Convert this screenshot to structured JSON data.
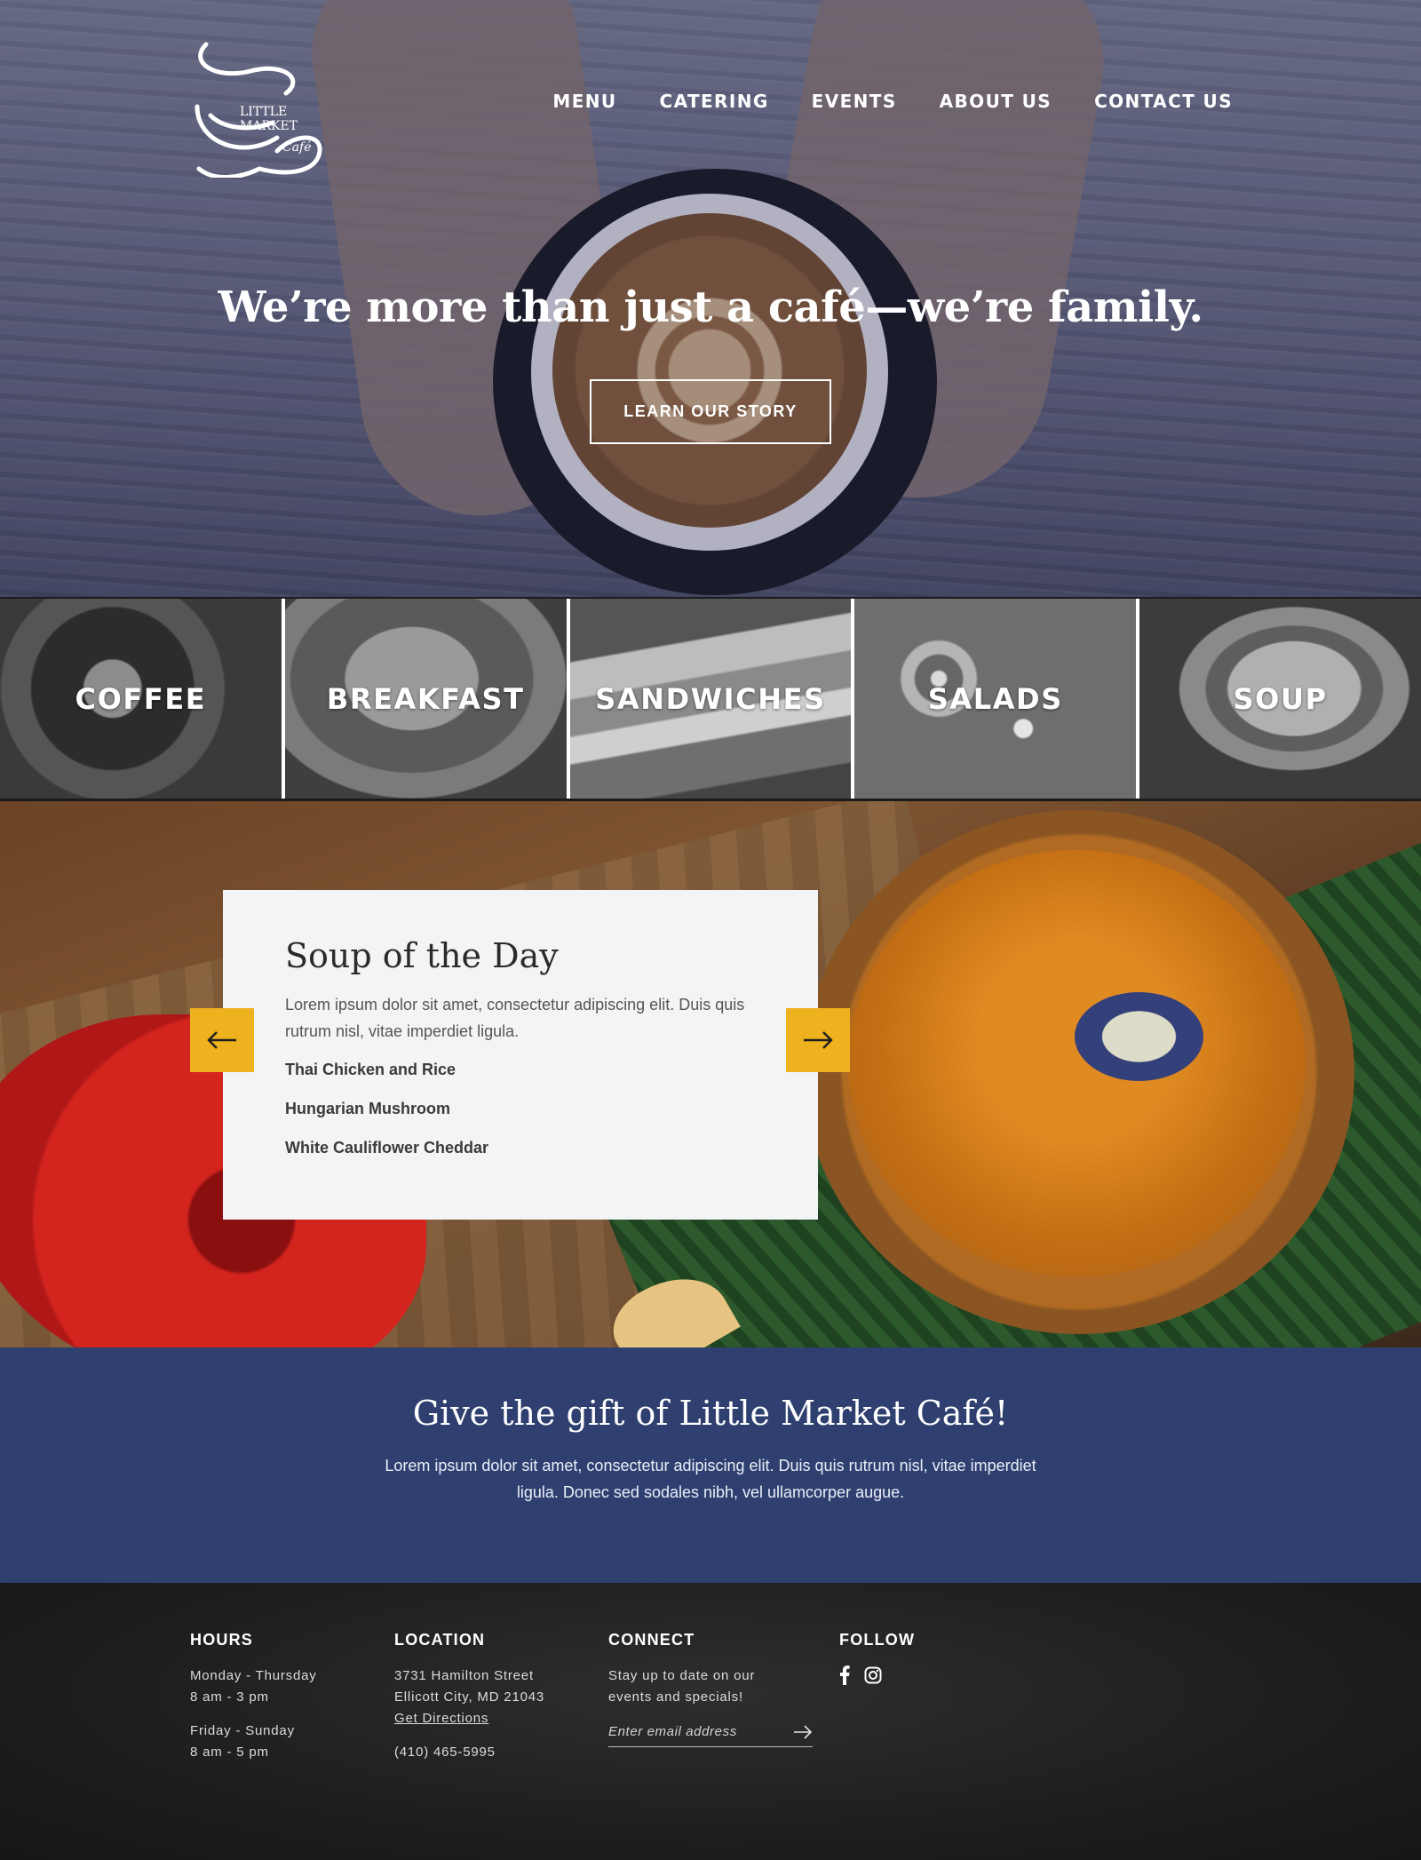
{
  "brand": {
    "logo_line1": "LITTLE",
    "logo_line2": "MARKET",
    "logo_line3": "Café"
  },
  "nav": {
    "items": [
      "MENU",
      "CATERING",
      "EVENTS",
      "ABOUT US",
      "CONTACT US"
    ]
  },
  "hero": {
    "title": "We’re more than just a café—we’re family.",
    "cta": "LEARN OUR STORY"
  },
  "categories": [
    "COFFEE",
    "BREAKFAST",
    "SANDWICHES",
    "SALADS",
    "SOUP"
  ],
  "soup": {
    "title": "Soup of the Day",
    "description": "Lorem ipsum dolor sit amet, consectetur adipiscing elit. Duis quis rutrum nisl, vitae imperdiet ligula.",
    "items": [
      "Thai Chicken and Rice",
      "Hungarian Mushroom",
      "White Cauliflower Cheddar"
    ]
  },
  "gift": {
    "title": "Give the gift of Little Market Café!",
    "text": "Lorem ipsum dolor sit amet, consectetur adipiscing elit. Duis quis rutrum nisl, vitae imperdiet ligula. Donec sed sodales nibh, vel ullamcorper augue."
  },
  "footer": {
    "hours": {
      "heading": "HOURS",
      "weekday_days": "Monday - Thursday",
      "weekday_time": "8 am - 3 pm",
      "weekend_days": "Friday - Sunday",
      "weekend_time": "8 am - 5 pm"
    },
    "location": {
      "heading": "LOCATION",
      "street": "3731 Hamilton Street",
      "city": "Ellicott City, MD 21043",
      "directions": "Get Directions",
      "phone": "(410) 465-5995"
    },
    "connect": {
      "heading": "CONNECT",
      "text_line1": "Stay up to date on our",
      "text_line2": "events and specials!",
      "email_placeholder": "Enter email address"
    },
    "follow": {
      "heading": "FOLLOW",
      "icons": [
        "facebook-icon",
        "instagram-icon"
      ]
    }
  },
  "colors": {
    "accent_yellow": "#efb21f",
    "gift_blue": "#2f4070",
    "card_bg": "#f3f4f6"
  }
}
